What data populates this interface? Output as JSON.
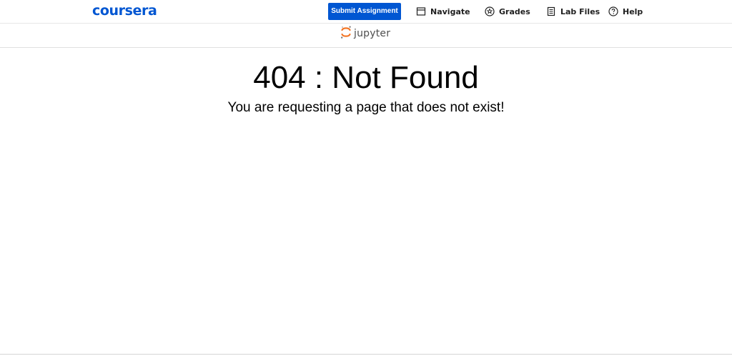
{
  "header": {
    "brand": "coursera",
    "brand_color": "#0056d2",
    "submit_label": "Submit Assignment",
    "nav": [
      {
        "label": "Navigate",
        "icon": "browser-window-icon"
      },
      {
        "label": "Grades",
        "icon": "star-badge-icon"
      },
      {
        "label": "Lab Files",
        "icon": "document-icon"
      },
      {
        "label": "Help",
        "icon": "question-circle-icon"
      }
    ]
  },
  "jupyter": {
    "logo_text": "jupyter",
    "logo_color": "#f37626"
  },
  "error": {
    "title": "404 : Not Found",
    "message": "You are requesting a page that does not exist!"
  }
}
